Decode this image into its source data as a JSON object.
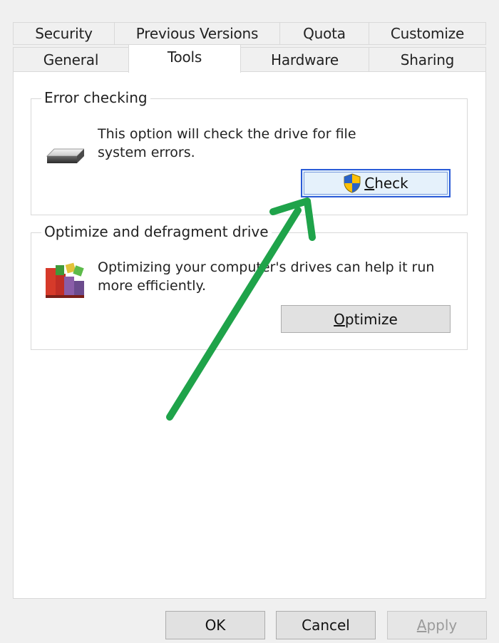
{
  "tabs": {
    "row1": [
      "Security",
      "Previous Versions",
      "Quota",
      "Customize"
    ],
    "row2": [
      "General",
      "Tools",
      "Hardware",
      "Sharing"
    ],
    "active": "Tools"
  },
  "error_checking": {
    "title": "Error checking",
    "description_line1": "This option will check the drive for file",
    "description_line2": "system errors.",
    "button": {
      "mnemonic": "C",
      "rest": "heck",
      "icon": "uac-shield-icon"
    }
  },
  "optimize": {
    "title": "Optimize and defragment drive",
    "description_line1": "Optimizing your computer's drives can help it run",
    "description_line2": "more efficiently.",
    "button": {
      "mnemonic": "O",
      "rest": "ptimize",
      "icon": "defrag-icon"
    }
  },
  "footer": {
    "ok": "OK",
    "cancel": "Cancel",
    "apply_mnemonic": "A",
    "apply_rest": "pply"
  },
  "colors": {
    "annotation_arrow": "#1fa34a",
    "focus_border": "#2a5bd7"
  }
}
